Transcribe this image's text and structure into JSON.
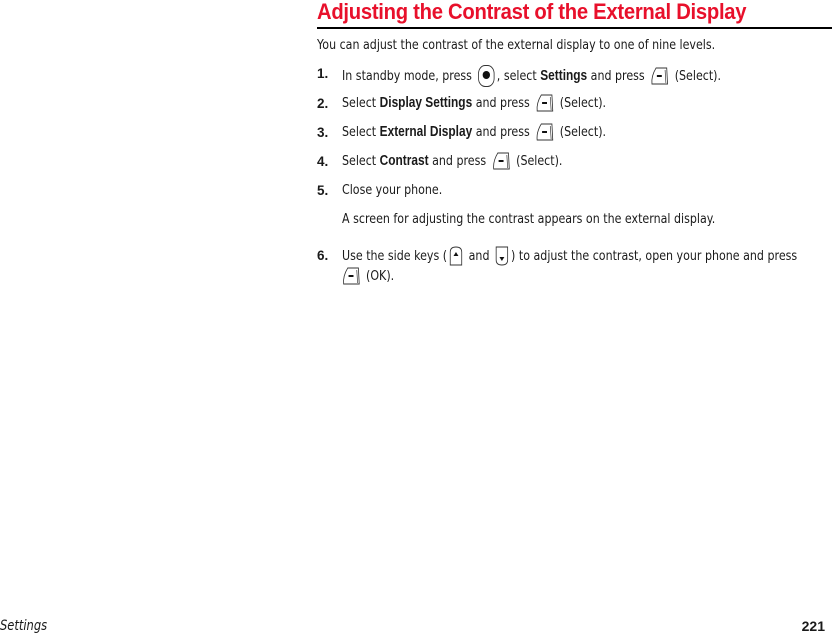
{
  "heading": {
    "title": "Adjusting the Contrast of the External Display",
    "accent_color": "#e8102b"
  },
  "intro": "You can adjust the contrast of the external display to one of nine levels.",
  "steps": [
    {
      "number": "1.",
      "parts": {
        "a": "In standby mode, press",
        "b": ", select",
        "bold": "Settings",
        "c": "and press",
        "d": "(Select)."
      },
      "icons": [
        "center-nav-key-icon",
        "left-softkey-icon"
      ]
    },
    {
      "number": "2.",
      "parts": {
        "a": "Select",
        "bold": "Display Settings",
        "c": "and press",
        "d": "(Select)."
      },
      "icons": [
        "left-softkey-icon"
      ]
    },
    {
      "number": "3.",
      "parts": {
        "a": "Select",
        "bold": "External Display",
        "c": "and press",
        "d": "(Select)."
      },
      "icons": [
        "left-softkey-icon"
      ]
    },
    {
      "number": "4.",
      "parts": {
        "a": "Select",
        "bold": "Contrast",
        "c": "and press",
        "d": "(Select)."
      },
      "icons": [
        "left-softkey-icon"
      ]
    },
    {
      "number": "5.",
      "parts": {
        "a": "Close your phone."
      },
      "note": "A screen for adjusting the contrast appears on the external display."
    },
    {
      "number": "6.",
      "parts": {
        "a": "Use the side keys (",
        "b": "and",
        "c": ") to adjust the contrast, open your phone and press",
        "d": "(OK)."
      },
      "icons": [
        "side-key-up-icon",
        "side-key-down-icon",
        "left-softkey-icon"
      ]
    }
  ],
  "footer": {
    "section": "Settings",
    "page_number": "221"
  }
}
